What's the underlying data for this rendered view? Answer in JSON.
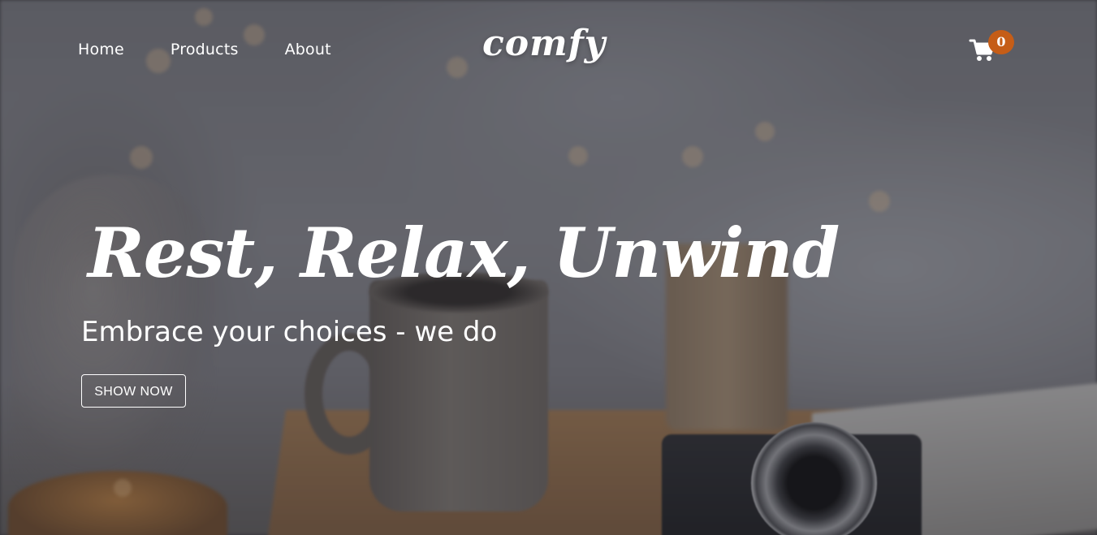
{
  "nav": {
    "links": [
      {
        "label": "Home"
      },
      {
        "label": "Products"
      },
      {
        "label": "About"
      }
    ],
    "logo": "comfy",
    "cart": {
      "icon": "shopping-cart-icon",
      "count": "0",
      "badge_color": "#c55d17"
    }
  },
  "hero": {
    "headline": "Rest, Relax, Unwind",
    "subheadline": "Embrace your choices - we do",
    "cta_label": "SHOW NOW"
  }
}
